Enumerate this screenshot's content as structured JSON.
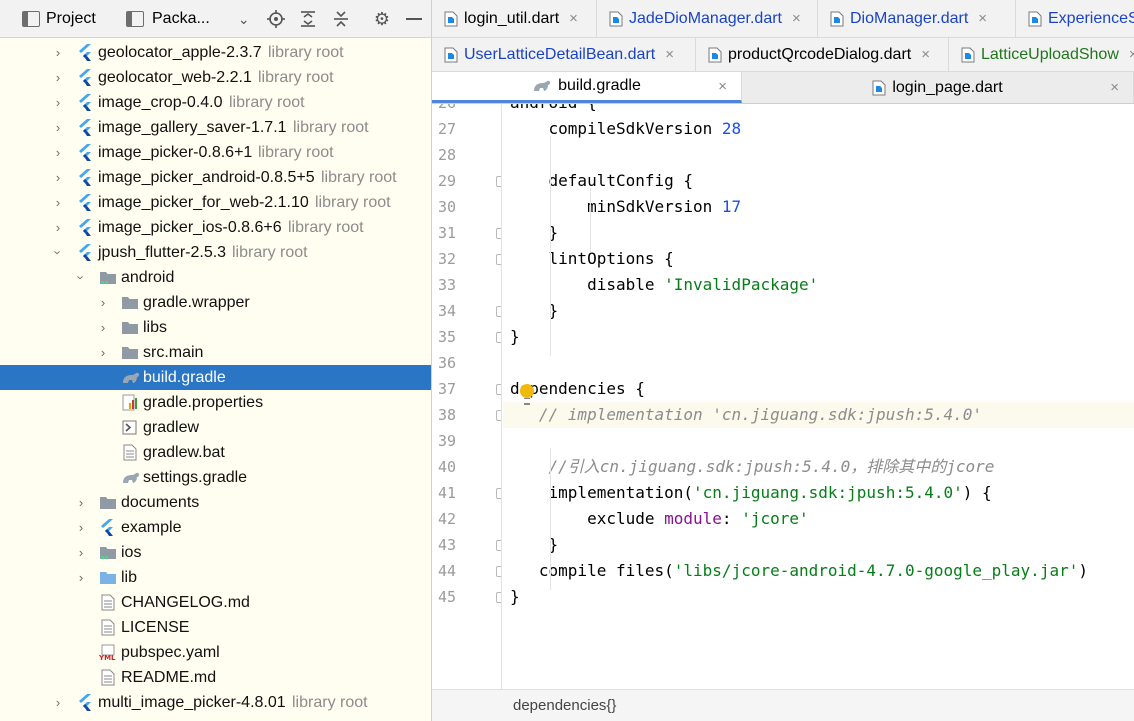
{
  "project_panel": {
    "view_label": "Project",
    "packages_label": "Packa...",
    "icons": [
      "locate-icon",
      "expand-all-icon",
      "collapse-all-icon",
      "settings-icon",
      "hide-icon"
    ]
  },
  "tree": [
    {
      "label": "geolocator_apple-2.3.7",
      "suffix": "library root",
      "depth": 0,
      "arrow": "closed",
      "icon": "flutter"
    },
    {
      "label": "geolocator_web-2.2.1",
      "suffix": "library root",
      "depth": 0,
      "arrow": "closed",
      "icon": "flutter"
    },
    {
      "label": "image_crop-0.4.0",
      "suffix": "library root",
      "depth": 0,
      "arrow": "closed",
      "icon": "flutter"
    },
    {
      "label": "image_gallery_saver-1.7.1",
      "suffix": "library root",
      "depth": 0,
      "arrow": "closed",
      "icon": "flutter"
    },
    {
      "label": "image_picker-0.8.6+1",
      "suffix": "library root",
      "depth": 0,
      "arrow": "closed",
      "icon": "flutter"
    },
    {
      "label": "image_picker_android-0.8.5+5",
      "suffix": "library root",
      "depth": 0,
      "arrow": "closed",
      "icon": "flutter"
    },
    {
      "label": "image_picker_for_web-2.1.10",
      "suffix": "library root",
      "depth": 0,
      "arrow": "closed",
      "icon": "flutter"
    },
    {
      "label": "image_picker_ios-0.8.6+6",
      "suffix": "library root",
      "depth": 0,
      "arrow": "closed",
      "icon": "flutter"
    },
    {
      "label": "jpush_flutter-2.5.3",
      "suffix": "library root",
      "depth": 0,
      "arrow": "open",
      "icon": "flutter"
    },
    {
      "label": "android",
      "suffix": "",
      "depth": 1,
      "arrow": "open",
      "icon": "folder-android"
    },
    {
      "label": "gradle.wrapper",
      "suffix": "",
      "depth": 2,
      "arrow": "closed",
      "icon": "folder"
    },
    {
      "label": "libs",
      "suffix": "",
      "depth": 2,
      "arrow": "closed",
      "icon": "folder"
    },
    {
      "label": "src.main",
      "suffix": "",
      "depth": 2,
      "arrow": "closed",
      "icon": "folder"
    },
    {
      "label": "build.gradle",
      "suffix": "",
      "depth": 2,
      "arrow": "none",
      "icon": "gradle",
      "selected": true
    },
    {
      "label": "gradle.properties",
      "suffix": "",
      "depth": 2,
      "arrow": "none",
      "icon": "properties"
    },
    {
      "label": "gradlew",
      "suffix": "",
      "depth": 2,
      "arrow": "none",
      "icon": "script"
    },
    {
      "label": "gradlew.bat",
      "suffix": "",
      "depth": 2,
      "arrow": "none",
      "icon": "file"
    },
    {
      "label": "settings.gradle",
      "suffix": "",
      "depth": 2,
      "arrow": "none",
      "icon": "gradle"
    },
    {
      "label": "documents",
      "suffix": "",
      "depth": 1,
      "arrow": "closed",
      "icon": "folder"
    },
    {
      "label": "example",
      "suffix": "",
      "depth": 1,
      "arrow": "closed",
      "icon": "flutter"
    },
    {
      "label": "ios",
      "suffix": "",
      "depth": 1,
      "arrow": "closed",
      "icon": "folder-android"
    },
    {
      "label": "lib",
      "suffix": "",
      "depth": 1,
      "arrow": "closed",
      "icon": "folder-blue"
    },
    {
      "label": "CHANGELOG.md",
      "suffix": "",
      "depth": 1,
      "arrow": "none",
      "icon": "file"
    },
    {
      "label": "LICENSE",
      "suffix": "",
      "depth": 1,
      "arrow": "none",
      "icon": "file"
    },
    {
      "label": "pubspec.yaml",
      "suffix": "",
      "depth": 1,
      "arrow": "none",
      "icon": "yaml"
    },
    {
      "label": "README.md",
      "suffix": "",
      "depth": 1,
      "arrow": "none",
      "icon": "file"
    },
    {
      "label": "multi_image_picker-4.8.01",
      "suffix": "library root",
      "depth": 0,
      "arrow": "closed",
      "icon": "flutter"
    }
  ],
  "tabs_row1": [
    {
      "name": "login_util.dart",
      "style": "plain",
      "icon": "dart-file-icon"
    },
    {
      "name": "JadeDioManager.dart",
      "style": "blue",
      "icon": "dart-file-icon"
    },
    {
      "name": "DioManager.dart",
      "style": "blue",
      "icon": "dart-file-icon"
    },
    {
      "name": "ExperienceSt",
      "style": "blue",
      "icon": "dart-file-icon"
    }
  ],
  "tabs_row2": [
    {
      "name": "UserLatticeDetailBean.dart",
      "style": "blue",
      "icon": "dart-file-icon"
    },
    {
      "name": "productQrcodeDialog.dart",
      "style": "plain",
      "icon": "dart-file-icon"
    },
    {
      "name": "LatticeUploadShow",
      "style": "green",
      "icon": "dart-file-icon"
    }
  ],
  "tabs_row3": [
    {
      "name": "build.gradle",
      "style": "plain",
      "icon": "gradle-file-icon",
      "active": true
    },
    {
      "name": "login_page.dart",
      "style": "plain",
      "icon": "dart-file-icon",
      "active": false
    }
  ],
  "tab_close_glyph": "×",
  "editor": {
    "partial_first_line": "android {",
    "partial_first_number": "26",
    "lines": [
      {
        "n": "27",
        "code": [
          [
            "    compileSdkVersion ",
            ""
          ],
          [
            "28",
            "num"
          ]
        ]
      },
      {
        "n": "28",
        "code": []
      },
      {
        "n": "29",
        "code": [
          [
            "    defaultConfig {",
            ""
          ]
        ]
      },
      {
        "n": "30",
        "code": [
          [
            "        minSdkVersion ",
            ""
          ],
          [
            "17",
            "num"
          ]
        ]
      },
      {
        "n": "31",
        "code": [
          [
            "    }",
            ""
          ]
        ]
      },
      {
        "n": "32",
        "code": [
          [
            "    lintOptions {",
            ""
          ]
        ]
      },
      {
        "n": "33",
        "code": [
          [
            "        disable ",
            ""
          ],
          [
            "'InvalidPackage'",
            "str"
          ]
        ]
      },
      {
        "n": "34",
        "code": [
          [
            "    }",
            ""
          ]
        ]
      },
      {
        "n": "35",
        "code": [
          [
            "}",
            ""
          ]
        ]
      },
      {
        "n": "36",
        "code": []
      },
      {
        "n": "37",
        "code": [
          [
            "dependencies {",
            ""
          ]
        ]
      },
      {
        "n": "38",
        "code": [
          [
            "   // implementation 'cn.jiguang.sdk:jpush:5.4.0'",
            "com"
          ]
        ],
        "highlight": true
      },
      {
        "n": "39",
        "code": []
      },
      {
        "n": "40",
        "code": [
          [
            "    //引入cn.jiguang.sdk:jpush:5.4.0，排除其中的jcore",
            "com"
          ]
        ]
      },
      {
        "n": "41",
        "code": [
          [
            "    implementation(",
            ""
          ],
          [
            "'cn.jiguang.sdk:jpush:5.4.0'",
            "str"
          ],
          [
            ") {",
            ""
          ]
        ]
      },
      {
        "n": "42",
        "code": [
          [
            "        exclude ",
            ""
          ],
          [
            "module",
            "mod"
          ],
          [
            ": ",
            ""
          ],
          [
            "'jcore'",
            "str"
          ]
        ]
      },
      {
        "n": "43",
        "code": [
          [
            "    }",
            ""
          ]
        ]
      },
      {
        "n": "44",
        "code": [
          [
            "   compile files(",
            ""
          ],
          [
            "'libs/jcore-android-4.7.0-google_play.jar'",
            "str"
          ],
          [
            ")",
            ""
          ]
        ]
      },
      {
        "n": "45",
        "code": [
          [
            "}",
            ""
          ]
        ]
      }
    ]
  },
  "breadcrumb": "dependencies{}",
  "colors": {
    "selection": "#2b75c5",
    "project_bg": "#fffef0",
    "tab_blue": "#1a44c8",
    "number": "#1750eb",
    "string": "#067d17",
    "comment": "#8c8c8c"
  }
}
